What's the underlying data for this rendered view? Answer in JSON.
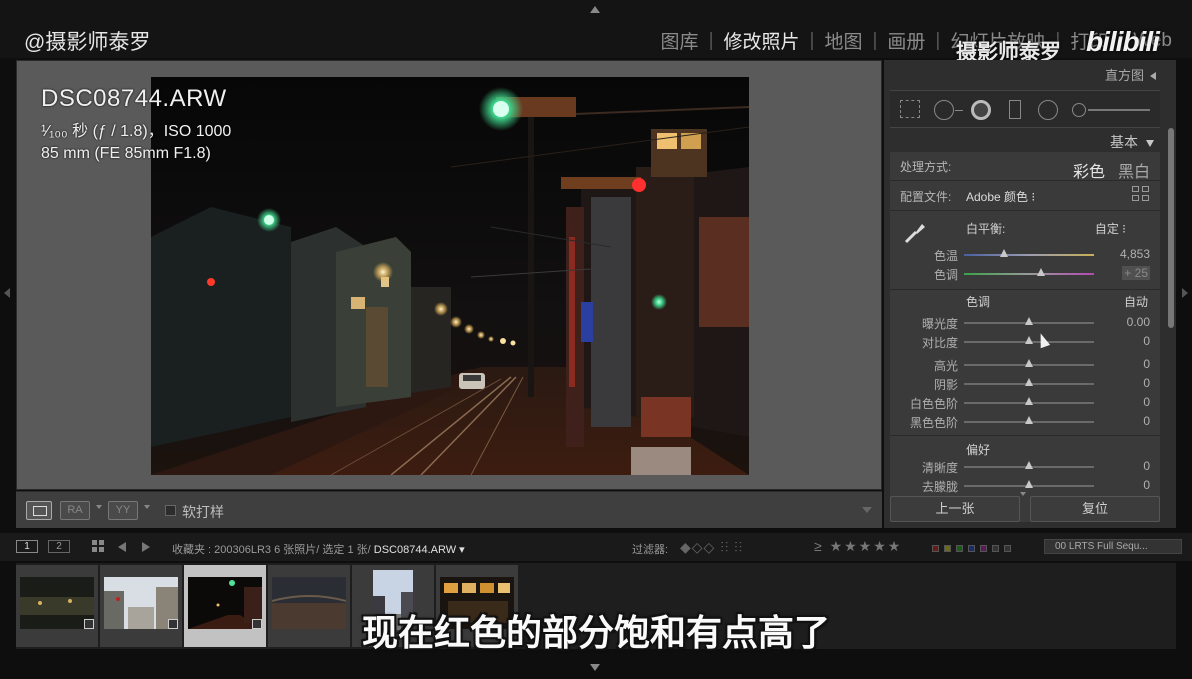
{
  "watermark": {
    "user": "@摄影师泰罗",
    "channel": "摄影师泰罗",
    "logo": "bilibili"
  },
  "modules": [
    "图库",
    "修改照片",
    "地图",
    "画册",
    "幻灯片放映",
    "打印",
    "Web"
  ],
  "active_module": "修改照片",
  "photo_info": {
    "filename": "DSC08744.ARW",
    "exposure": "¹⁄₁₀₀ 秒 (ƒ / 1.8)，ISO 1000",
    "lens": "85 mm (FE 85mm F1.8)"
  },
  "toolbar": {
    "ra_label": "RA",
    "yy_label": "YY",
    "softproof_label": "软打样"
  },
  "right_panel": {
    "histogram_label": "直方图",
    "basic_label": "基本",
    "treatment_label": "处理方式:",
    "treatment_color": "彩色",
    "treatment_bw": "黑白",
    "profile_label": "配置文件:",
    "profile_value": "Adobe 颜色 ⁝",
    "wb_label": "白平衡:",
    "wb_value": "自定 ⁝",
    "tone_label": "色调",
    "auto_label": "自动",
    "presence_label": "偏好",
    "sliders_wb": [
      {
        "name": "色温",
        "value": "4,853",
        "pos": 0.31
      },
      {
        "name": "色调",
        "value": "+ 25",
        "pos": 0.59
      }
    ],
    "sliders_tone": [
      {
        "name": "曝光度",
        "value": "0.00",
        "pos": 0.5
      },
      {
        "name": "对比度",
        "value": "0",
        "pos": 0.5
      }
    ],
    "sliders_tone2": [
      {
        "name": "高光",
        "value": "0",
        "pos": 0.5
      },
      {
        "name": "阴影",
        "value": "0",
        "pos": 0.5
      },
      {
        "name": "白色色阶",
        "value": "0",
        "pos": 0.5
      },
      {
        "name": "黑色色阶",
        "value": "0",
        "pos": 0.5
      }
    ],
    "sliders_presence": [
      {
        "name": "清晰度",
        "value": "0",
        "pos": 0.5
      },
      {
        "name": "去朦胧",
        "value": "0",
        "pos": 0.5
      }
    ],
    "prev_button": "上一张",
    "reset_button": "复位"
  },
  "filmstrip_bar": {
    "view1": "1",
    "view2": "2",
    "source": "收藏夹 : 200306LR3   6 张照片/ 选定 1 张/ ",
    "current_file": "DSC08744.ARW ▾",
    "filter_label": "过滤器:",
    "stars": "≥ ★★★★★",
    "preset": "00 LRTS Full Sequ..."
  },
  "filmstrip": {
    "thumbnails": [
      {
        "name": "thumb-1",
        "selected": false
      },
      {
        "name": "thumb-2",
        "selected": false
      },
      {
        "name": "thumb-3",
        "selected": true
      },
      {
        "name": "thumb-4",
        "selected": false
      },
      {
        "name": "thumb-5",
        "selected": false
      },
      {
        "name": "thumb-6",
        "selected": false
      }
    ]
  },
  "subtitle": "现在红色的部分饱和有点高了"
}
